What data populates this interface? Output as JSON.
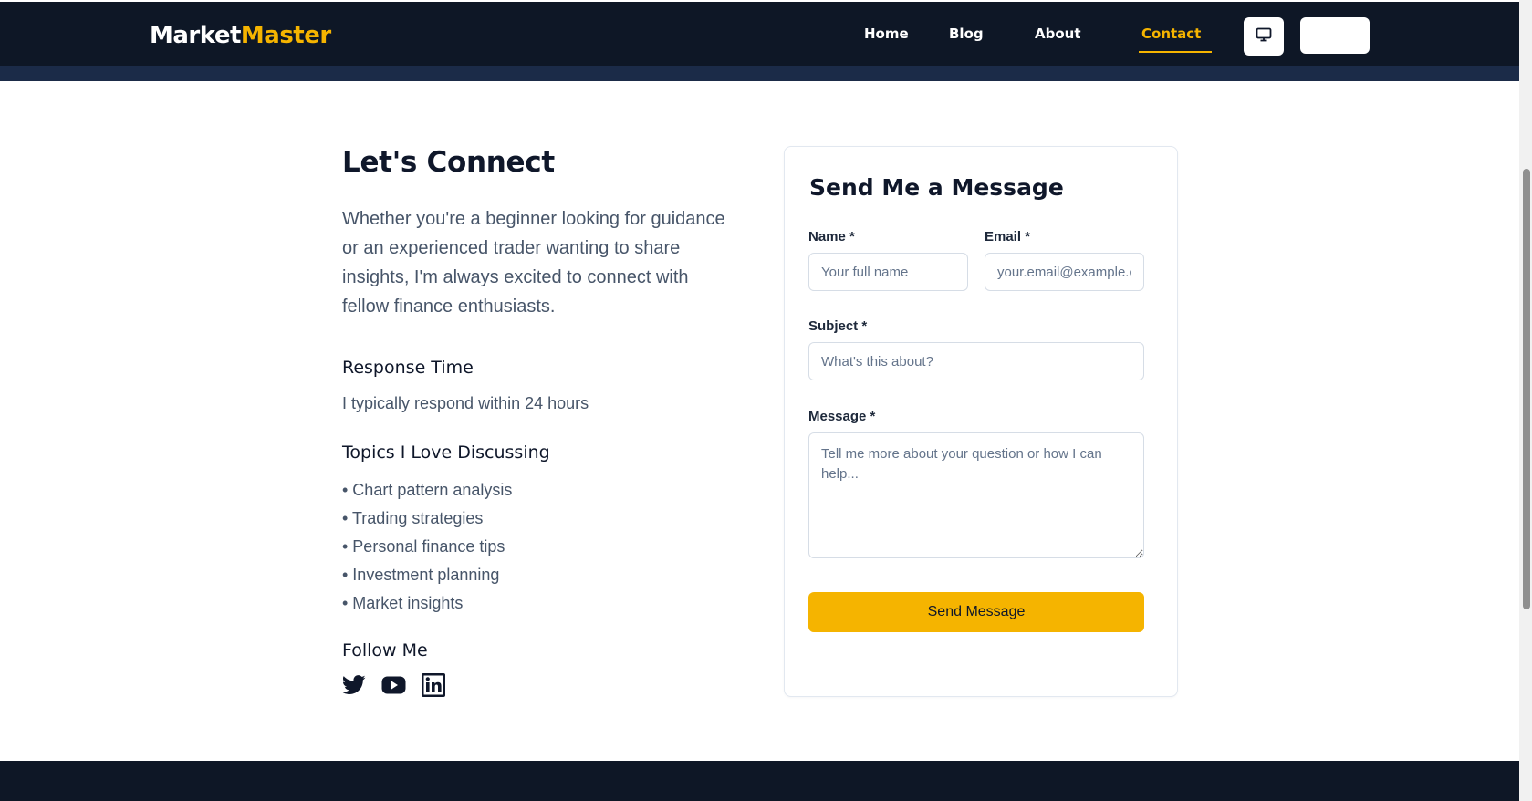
{
  "brand": {
    "part1": "Market",
    "part2": "Master"
  },
  "nav": {
    "home": "Home",
    "blog": "Blog",
    "about": "About",
    "contact": "Contact"
  },
  "header_icons": {
    "display": "monitor-icon"
  },
  "left": {
    "title": "Let's Connect",
    "intro": "Whether you're a beginner looking for guidance or an experienced trader wanting to share insights, I'm always excited to connect with fellow finance enthusiasts.",
    "response_title": "Response Time",
    "response_text": "I typically respond within 24 hours",
    "topics_title": "Topics I Love Discussing",
    "topics": [
      "• Chart pattern analysis",
      "• Trading strategies",
      "• Personal finance tips",
      "• Investment planning",
      "• Market insights"
    ],
    "follow_title": "Follow Me",
    "social_icons": [
      "twitter-icon",
      "youtube-icon",
      "linkedin-icon"
    ]
  },
  "form": {
    "title": "Send Me a Message",
    "name_label": "Name *",
    "name_placeholder": "Your full name",
    "name_value": "",
    "email_label": "Email *",
    "email_placeholder": "your.email@example.com",
    "email_value": "",
    "subject_label": "Subject *",
    "subject_placeholder": "What's this about?",
    "subject_value": "",
    "message_label": "Message *",
    "message_placeholder": "Tell me more about your question or how I can help...",
    "message_value": "",
    "submit_label": "Send Message"
  },
  "colors": {
    "navy": "#0e1726",
    "band": "#1b2b48",
    "accent": "#f5b400"
  }
}
